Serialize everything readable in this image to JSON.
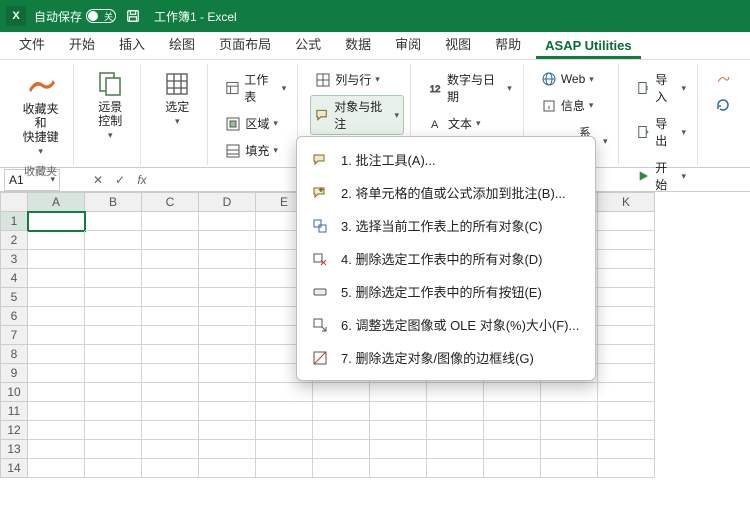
{
  "titlebar": {
    "autosave_label": "自动保存",
    "autosave_state": "关",
    "doc_title": "工作簿1  -  Excel"
  },
  "tabs": [
    "文件",
    "开始",
    "插入",
    "绘图",
    "页面布局",
    "公式",
    "数据",
    "审阅",
    "视图",
    "帮助",
    "ASAP Utilities"
  ],
  "active_tab": 10,
  "ribbon": {
    "fav_big": "收藏夹和\n快捷键",
    "fav_group_label": "收藏夹",
    "vision": "远景\n控制",
    "select": "选定",
    "worksheet": "工作表",
    "area": "区域",
    "fill": "填充",
    "cols_rows": "列与行",
    "objects_comments": "对象与批注",
    "numbers_dates": "数字与日期",
    "text": "文本",
    "web": "Web",
    "info": "信息",
    "system": "系统",
    "import": "导入",
    "export": "导出",
    "start": "开始"
  },
  "namebox": "A1",
  "fx": "fx",
  "col_headers": [
    "A",
    "B",
    "C",
    "D",
    "E",
    "",
    "",
    "",
    "",
    "J",
    "K"
  ],
  "row_headers": [
    1,
    2,
    3,
    4,
    5,
    6,
    7,
    8,
    9,
    10,
    11,
    12,
    13,
    14
  ],
  "dropdown": [
    "1.  批注工具(A)...",
    "2.  将单元格的值或公式添加到批注(B)...",
    "3.  选择当前工作表上的所有对象(C)",
    "4.  删除选定工作表中的所有对象(D)",
    "5.  删除选定工作表中的所有按钮(E)",
    "6.  调整选定图像或 OLE 对象(%)大小(F)...",
    "7.  删除选定对象/图像的边框线(G)"
  ]
}
